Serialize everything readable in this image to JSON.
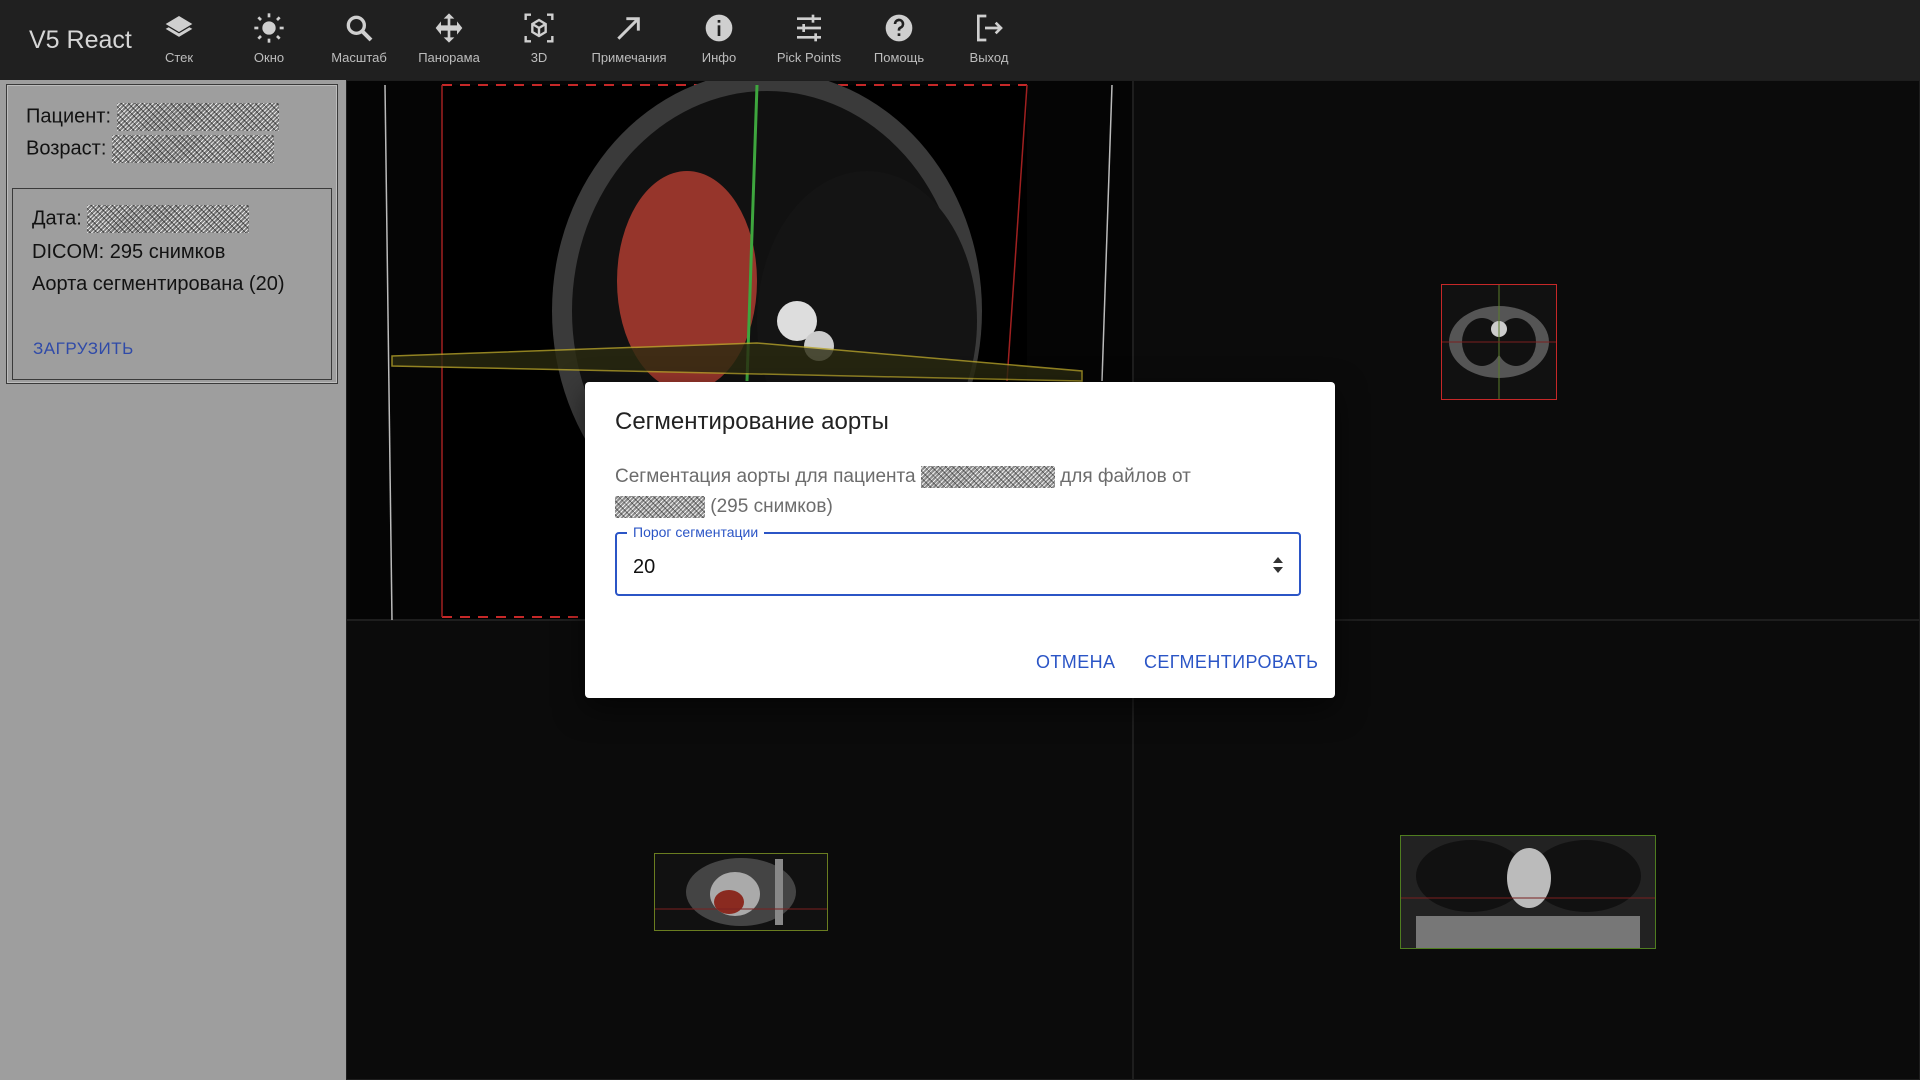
{
  "app": {
    "title": "V5 React"
  },
  "toolbar": {
    "items": [
      {
        "label": "Стек",
        "icon": "layers-icon"
      },
      {
        "label": "Окно",
        "icon": "sun-icon"
      },
      {
        "label": "Масштаб",
        "icon": "search-icon"
      },
      {
        "label": "Панорама",
        "icon": "move-icon"
      },
      {
        "label": "3D",
        "icon": "cube-3d-icon"
      },
      {
        "label": "Примечания",
        "icon": "arrow-diagonal-icon"
      },
      {
        "label": "Инфо",
        "icon": "info-icon"
      },
      {
        "label": "Pick Points",
        "icon": "sliders-icon"
      },
      {
        "label": "Помощь",
        "icon": "help-icon"
      },
      {
        "label": "Выход",
        "icon": "logout-icon"
      }
    ]
  },
  "patient": {
    "patient_label": "Пациент:",
    "age_label": "Возраст:"
  },
  "study": {
    "date_label": "Дата:",
    "dicom_text": "DICOM: 295 снимков",
    "aorta_text": "Аорта сегментирована (20)",
    "load_label": "ЗАГРУЗИТЬ"
  },
  "dialog": {
    "title": "Сегментирование аорты",
    "text_part1": "Сегментация аорты для пациента",
    "text_part2": "для файлов от",
    "text_part3": "(295 снимков)",
    "field_label": "Порог сегментации",
    "field_value": "20",
    "cancel_label": "ОТМЕНА",
    "segment_label": "СЕГМЕНТИРОВАТЬ"
  },
  "colors": {
    "accent": "#2b55c6",
    "topbar": "#202020",
    "panel": "#9e9e9e"
  }
}
